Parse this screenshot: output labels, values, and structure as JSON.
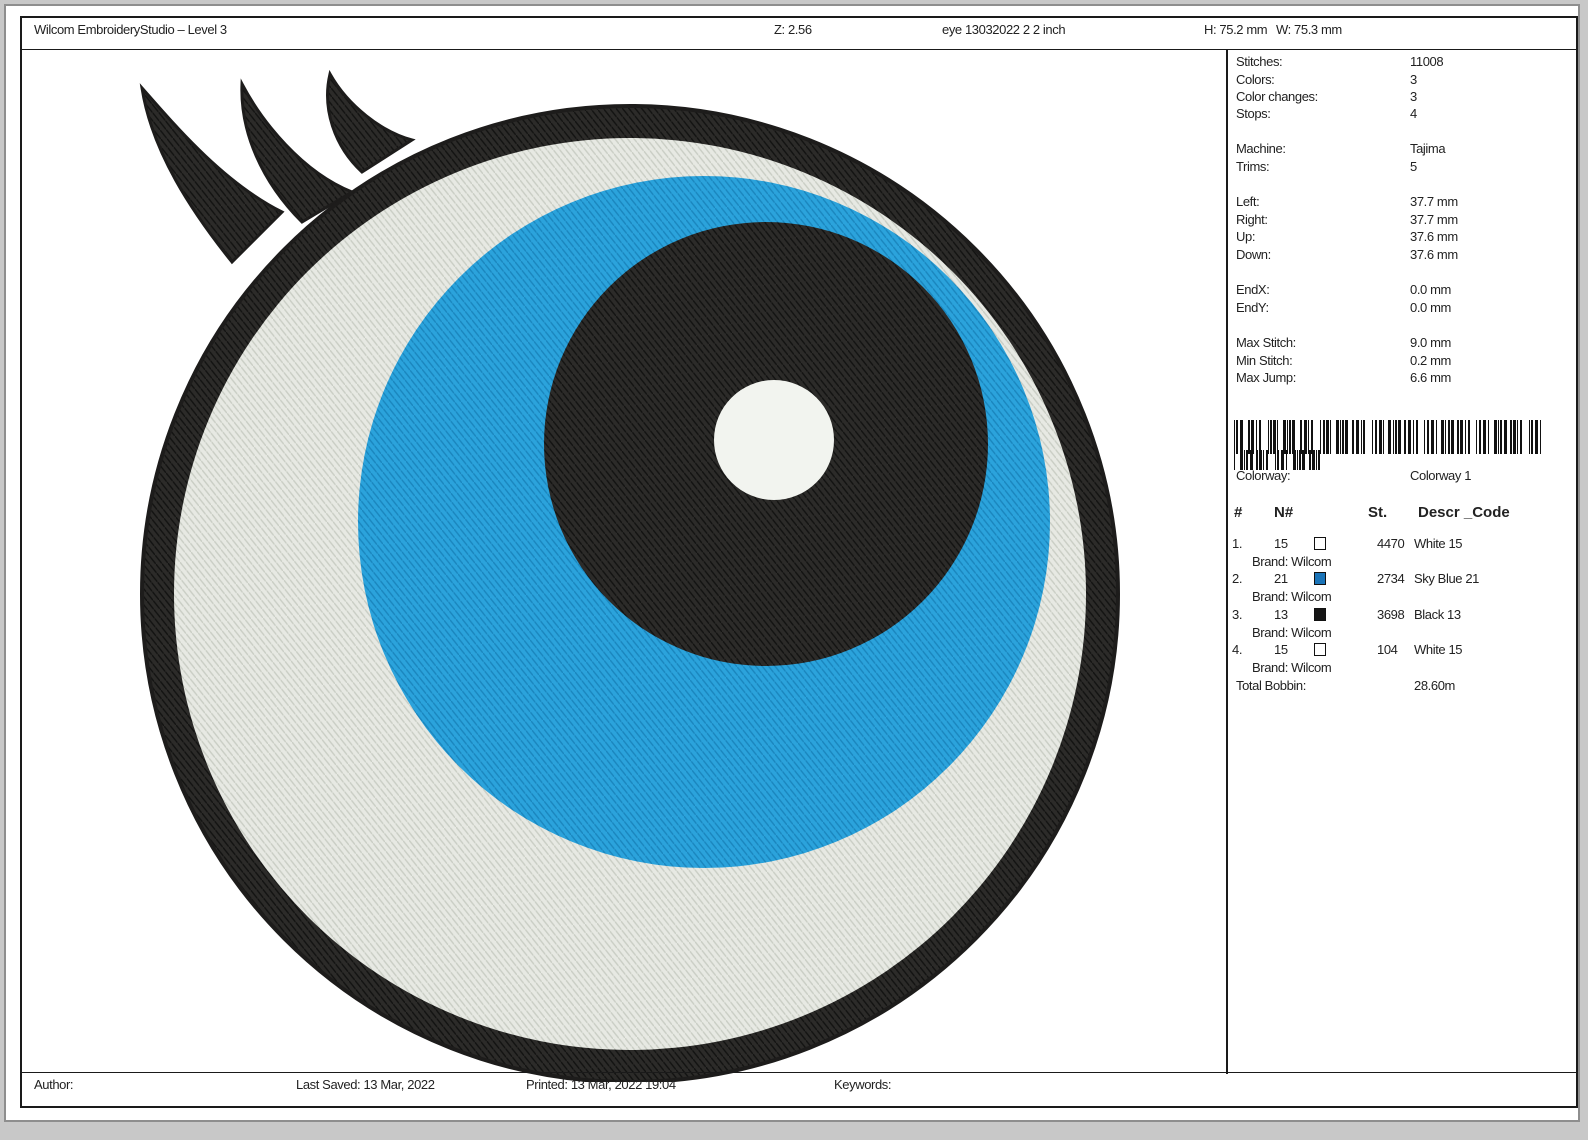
{
  "header": {
    "app_title": "Wilcom EmbroideryStudio – Level 3",
    "zoom": "Z: 2.56",
    "file_name": "eye 13032022 2 2 inch",
    "height": "H: 75.2 mm",
    "width": "W: 75.3 mm"
  },
  "stats": [
    {
      "label": "Stitches:",
      "value": "11008"
    },
    {
      "label": "Colors:",
      "value": "3"
    },
    {
      "label": "Color changes:",
      "value": "3"
    },
    {
      "label": "Stops:",
      "value": "4"
    },
    {
      "label": "Machine:",
      "value": "Tajima"
    },
    {
      "label": "Trims:",
      "value": "5"
    },
    {
      "label": "Left:",
      "value": "37.7 mm"
    },
    {
      "label": "Right:",
      "value": "37.7 mm"
    },
    {
      "label": "Up:",
      "value": "37.6 mm"
    },
    {
      "label": "Down:",
      "value": "37.6 mm"
    },
    {
      "label": "EndX:",
      "value": "0.0 mm"
    },
    {
      "label": "EndY:",
      "value": "0.0 mm"
    },
    {
      "label": "Max Stitch:",
      "value": "9.0 mm"
    },
    {
      "label": "Min Stitch:",
      "value": "0.2 mm"
    },
    {
      "label": "Max Jump:",
      "value": "6.6 mm"
    }
  ],
  "colorway": {
    "label": "Colorway:",
    "value": "Colorway 1"
  },
  "table": {
    "headers": {
      "num": "#",
      "n": "N#",
      "st": "St.",
      "desc": "Descr _Code"
    },
    "rows": [
      {
        "idx": "1.",
        "n": "15",
        "color": "#ffffff",
        "st": "4470",
        "desc": "White 15",
        "brand": "Brand: Wilcom"
      },
      {
        "idx": "2.",
        "n": "21",
        "color": "#1a74b8",
        "st": "2734",
        "desc": "Sky Blue 21",
        "brand": "Brand: Wilcom"
      },
      {
        "idx": "3.",
        "n": "13",
        "color": "#151515",
        "st": "3698",
        "desc": "Black 13",
        "brand": "Brand: Wilcom"
      },
      {
        "idx": "4.",
        "n": "15",
        "color": "#ffffff",
        "st": "104",
        "desc": "White 15",
        "brand": "Brand: Wilcom"
      }
    ],
    "total_label": "Total Bobbin:",
    "total_value": "28.60m"
  },
  "footer": {
    "author": "Author:",
    "last_saved": "Last Saved: 13 Mar, 2022",
    "printed": "Printed: 13 Mar, 2022 19:04",
    "keywords": "Keywords:"
  },
  "colors": {
    "outline": "#2b2a28",
    "sclera": "#e6e8e2",
    "iris": "#2aa0d8",
    "pupil": "#2a2927",
    "highlight": "#f4f6f2"
  }
}
